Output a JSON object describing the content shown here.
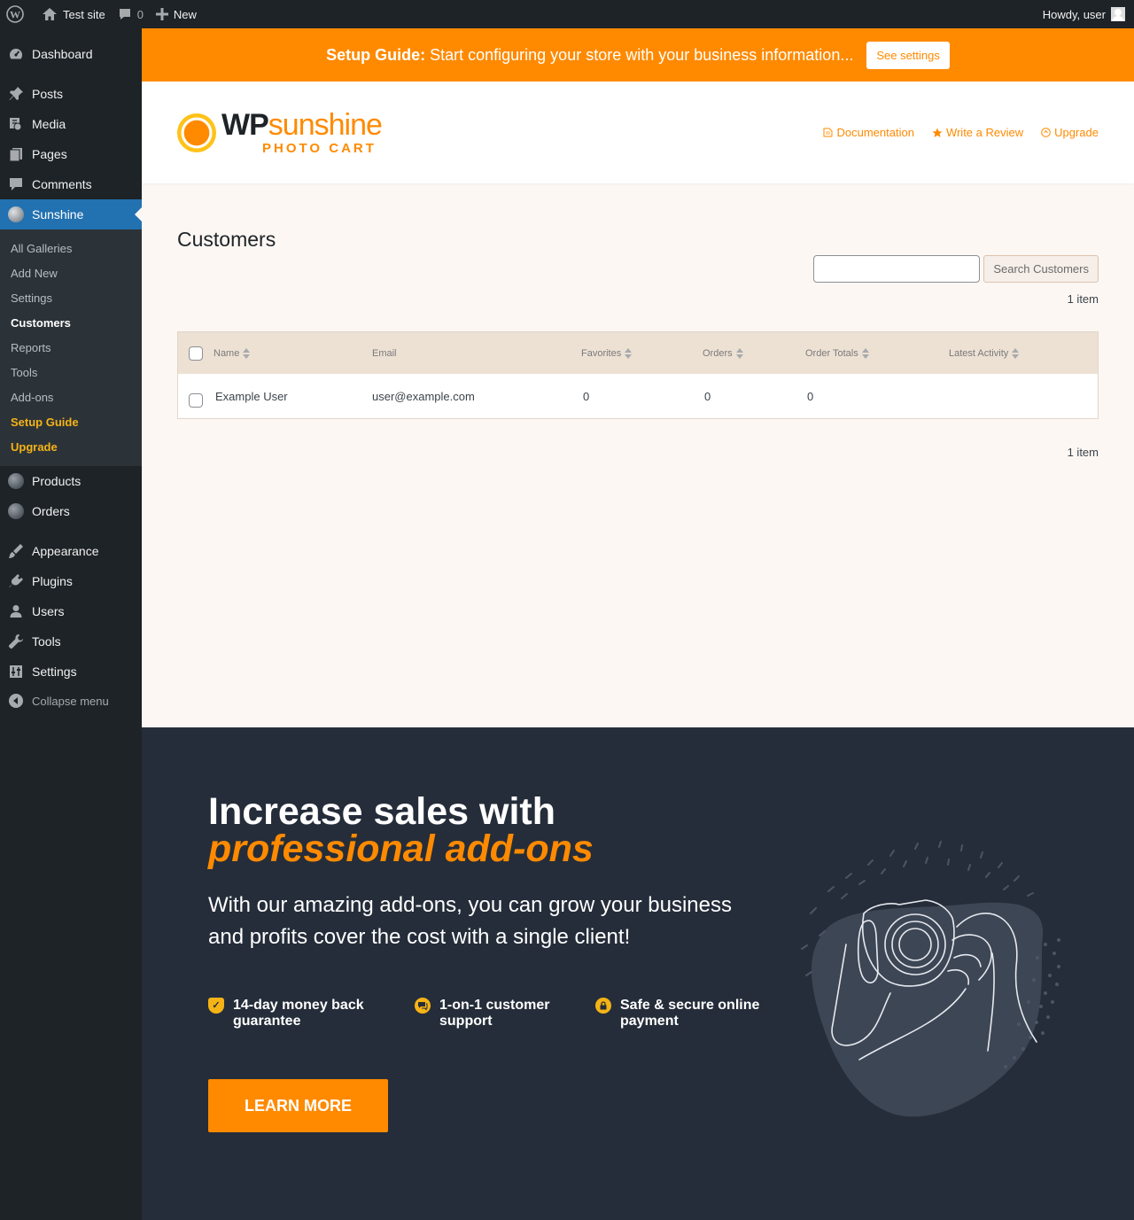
{
  "adminbar": {
    "site_name": "Test site",
    "comments_count": "0",
    "new_label": "New",
    "greeting": "Howdy, user"
  },
  "sidebar": {
    "items_top": [
      {
        "label": "Dashboard",
        "icon": "dashboard-icon"
      },
      {
        "label": "Posts",
        "icon": "pushpin-icon"
      },
      {
        "label": "Media",
        "icon": "media-icon"
      },
      {
        "label": "Pages",
        "icon": "pages-icon"
      },
      {
        "label": "Comments",
        "icon": "comment-icon"
      },
      {
        "label": "Sunshine",
        "icon": "sunshine-icon"
      }
    ],
    "submenu": [
      "All Galleries",
      "Add New",
      "Settings",
      "Customers",
      "Reports",
      "Tools",
      "Add-ons",
      "Setup Guide",
      "Upgrade"
    ],
    "items_bottom": [
      {
        "label": "Products",
        "icon": "products-icon"
      },
      {
        "label": "Orders",
        "icon": "orders-icon"
      },
      {
        "label": "Appearance",
        "icon": "paintbrush-icon"
      },
      {
        "label": "Plugins",
        "icon": "plugin-icon"
      },
      {
        "label": "Users",
        "icon": "user-icon"
      },
      {
        "label": "Tools",
        "icon": "wrench-icon"
      },
      {
        "label": "Settings",
        "icon": "settings-icon"
      }
    ],
    "collapse_label": "Collapse menu"
  },
  "setup_banner": {
    "bold": "Setup Guide:",
    "text": "Start configuring your store with your business information...",
    "button": "See settings"
  },
  "header": {
    "logo_wp": "WP",
    "logo_sunshine": "sunshine",
    "logo_sub": "PHOTO CART",
    "links": [
      "Documentation",
      "Write a Review",
      "Upgrade"
    ]
  },
  "page": {
    "title": "Customers",
    "search_button": "Search Customers",
    "items_count": "1 item"
  },
  "table": {
    "columns": [
      "Name",
      "Email",
      "Favorites",
      "Orders",
      "Order Totals",
      "Latest Activity"
    ],
    "rows": [
      {
        "name": "Example User",
        "email": "user@example.com",
        "favorites": "0",
        "orders": "0",
        "order_totals": "0",
        "latest_activity": ""
      }
    ]
  },
  "promo": {
    "headline": "Increase sales with",
    "headline_accent": "professional add-ons",
    "description": "With our amazing add-ons, you can grow your business and profits cover the cost with a single client!",
    "features": [
      "14-day money back guarantee",
      "1-on-1 customer support",
      "Safe & secure online payment"
    ],
    "button": "LEARN MORE"
  },
  "colors": {
    "accent": "#ff8a00",
    "admin_dark": "#1d2327",
    "wp_blue": "#2271b1",
    "promo_bg": "#252d3a",
    "gold": "#f5b316"
  }
}
